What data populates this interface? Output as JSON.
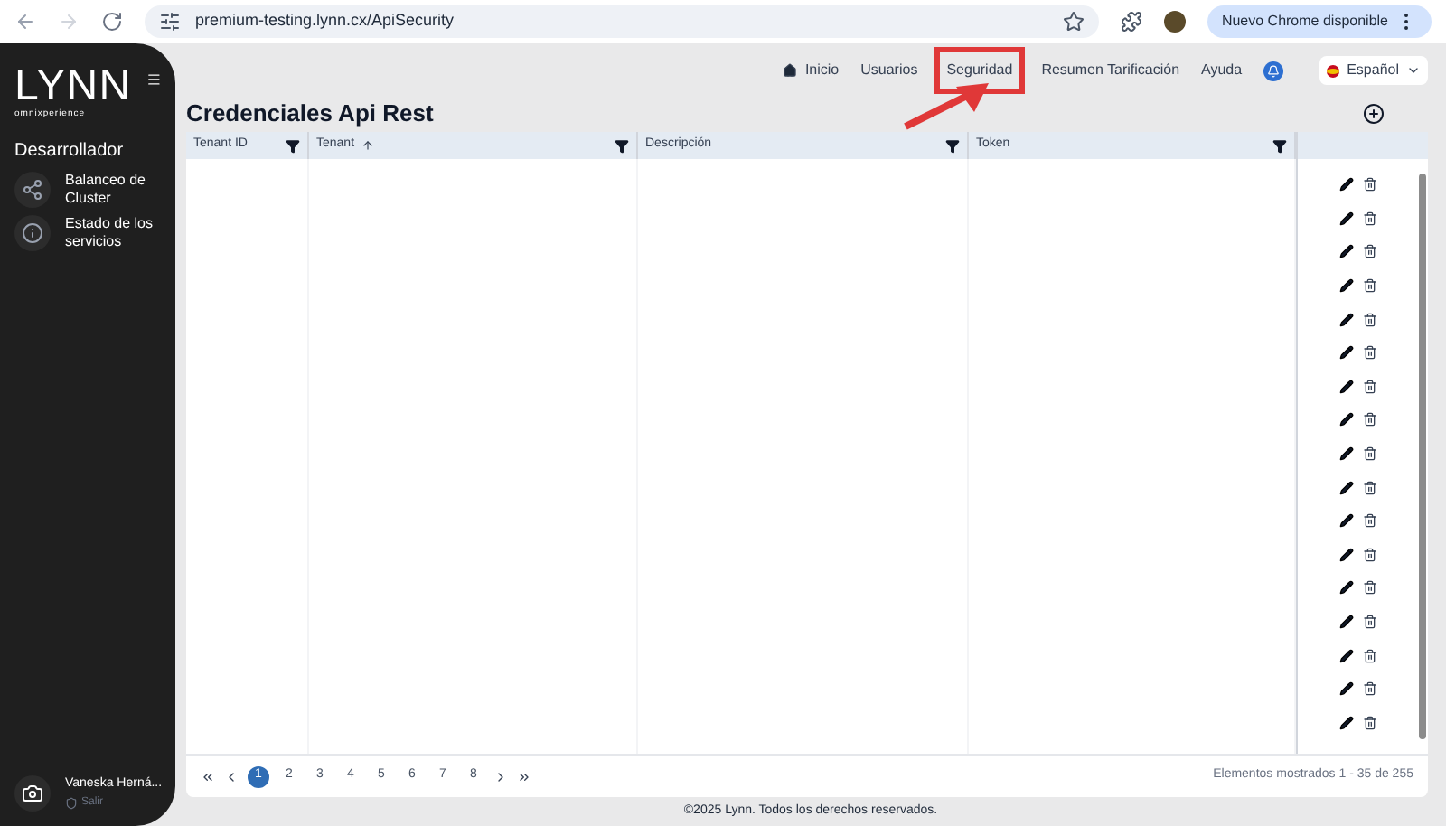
{
  "browser": {
    "url": "premium-testing.lynn.cx/ApiSecurity",
    "update_button": "Nuevo Chrome disponible"
  },
  "sidebar": {
    "logo": "LYNN",
    "logo_tagline": "omnixperience",
    "section": "Desarrollador",
    "items": [
      {
        "label": "Balanceo de Cluster",
        "kind": "cluster"
      },
      {
        "label": "Estado de los servicios",
        "kind": "info"
      }
    ],
    "user": {
      "name": "Vaneska Herná...",
      "logout": "Salir"
    }
  },
  "nav": {
    "items": [
      {
        "label": "Inicio",
        "kind": "home",
        "highlighted": false
      },
      {
        "label": "Usuarios",
        "kind": "text",
        "highlighted": false
      },
      {
        "label": "Seguridad",
        "kind": "text",
        "highlighted": true
      },
      {
        "label": "Resumen Tarificación",
        "kind": "text",
        "highlighted": false
      },
      {
        "label": "Ayuda",
        "kind": "text",
        "highlighted": false
      }
    ],
    "language": "Español"
  },
  "page": {
    "title": "Credenciales Api Rest"
  },
  "table": {
    "columns": [
      {
        "label": "Tenant ID",
        "filter": true,
        "sorted": false
      },
      {
        "label": "Tenant",
        "filter": true,
        "sorted": true
      },
      {
        "label": "Descripción",
        "filter": true,
        "sorted": false
      },
      {
        "label": "Token",
        "filter": true,
        "sorted": false
      }
    ]
  },
  "pagination": {
    "pages": [
      {
        "label": "1",
        "selected": true
      },
      {
        "label": "2",
        "selected": false
      },
      {
        "label": "3",
        "selected": false
      },
      {
        "label": "4",
        "selected": false
      },
      {
        "label": "5",
        "selected": false
      },
      {
        "label": "6",
        "selected": false
      },
      {
        "label": "7",
        "selected": false
      },
      {
        "label": "8",
        "selected": false
      }
    ],
    "summary": "Elementos mostrados 1 - 35 de 255"
  },
  "footer": "©2025 Lynn. Todos los derechos reservados."
}
